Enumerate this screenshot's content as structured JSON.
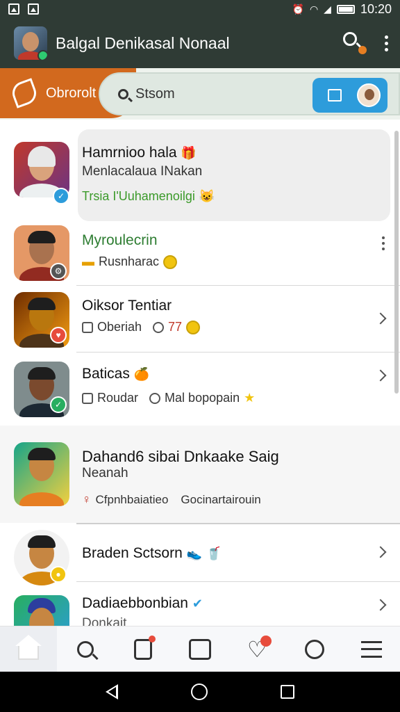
{
  "status_bar": {
    "time": "10:20"
  },
  "app_bar": {
    "title": "Balgal Denikasal Nonaal"
  },
  "tabs": {
    "active_label": "Obrorolt"
  },
  "search": {
    "placeholder": "Stsom"
  },
  "colors": {
    "appbar": "#2f3b35",
    "accent_orange": "#d2691e",
    "accent_blue": "#2d9cdb",
    "highlight_green": "#3b9a2a"
  },
  "list": [
    {
      "title": "Hamrnioo hala",
      "subtitle": "Menlacalaua INakan",
      "meta_text": "Trsia  I'Uuhamenoilgi",
      "title_icon": "gift-icon",
      "meta_icon": "cat-emoji-icon",
      "badge": "check-badge-icon"
    },
    {
      "title": "Myroulecrin",
      "meta_text": "Rusnharac",
      "meta_icon": "folder-icon",
      "meta_icon2": "coin-icon",
      "badge": "gear-badge-icon"
    },
    {
      "title": "Oiksor Tentiar",
      "meta_text": "Oberiah",
      "meta_text2": "77",
      "meta_icon": "image-icon",
      "meta_icon2": "user-icon",
      "badge": "heart-badge-icon"
    },
    {
      "title": "Baticas",
      "meta_text": "Roudar",
      "meta_text2": "Mal bopopain",
      "title_icon": "fruit-icon",
      "meta_icon": "mail-icon",
      "meta_icon2": "star-icon",
      "badge": "check-badge-icon"
    },
    {
      "title": "Dahand6 sibai Dnkaake Saig",
      "subtitle": "Neanah",
      "meta_text": "Cfpnhbaiatieo",
      "meta_text2": "Gocinartairouin",
      "meta_icon": "person-icon",
      "badge": ""
    },
    {
      "title": "Braden Sctsorn",
      "title_icon": "shoe-icon",
      "title_icon2": "drink-icon",
      "badge": "coin-badge-icon"
    },
    {
      "title": "Dadiaebbonbian",
      "subtitle": "Donkait",
      "title_icon": "verified-icon",
      "badge": ""
    }
  ],
  "bottom_nav": [
    "home-icon",
    "search-icon",
    "clipboard-icon",
    "list-icon",
    "heart-icon",
    "user-icon",
    "menu-icon"
  ]
}
